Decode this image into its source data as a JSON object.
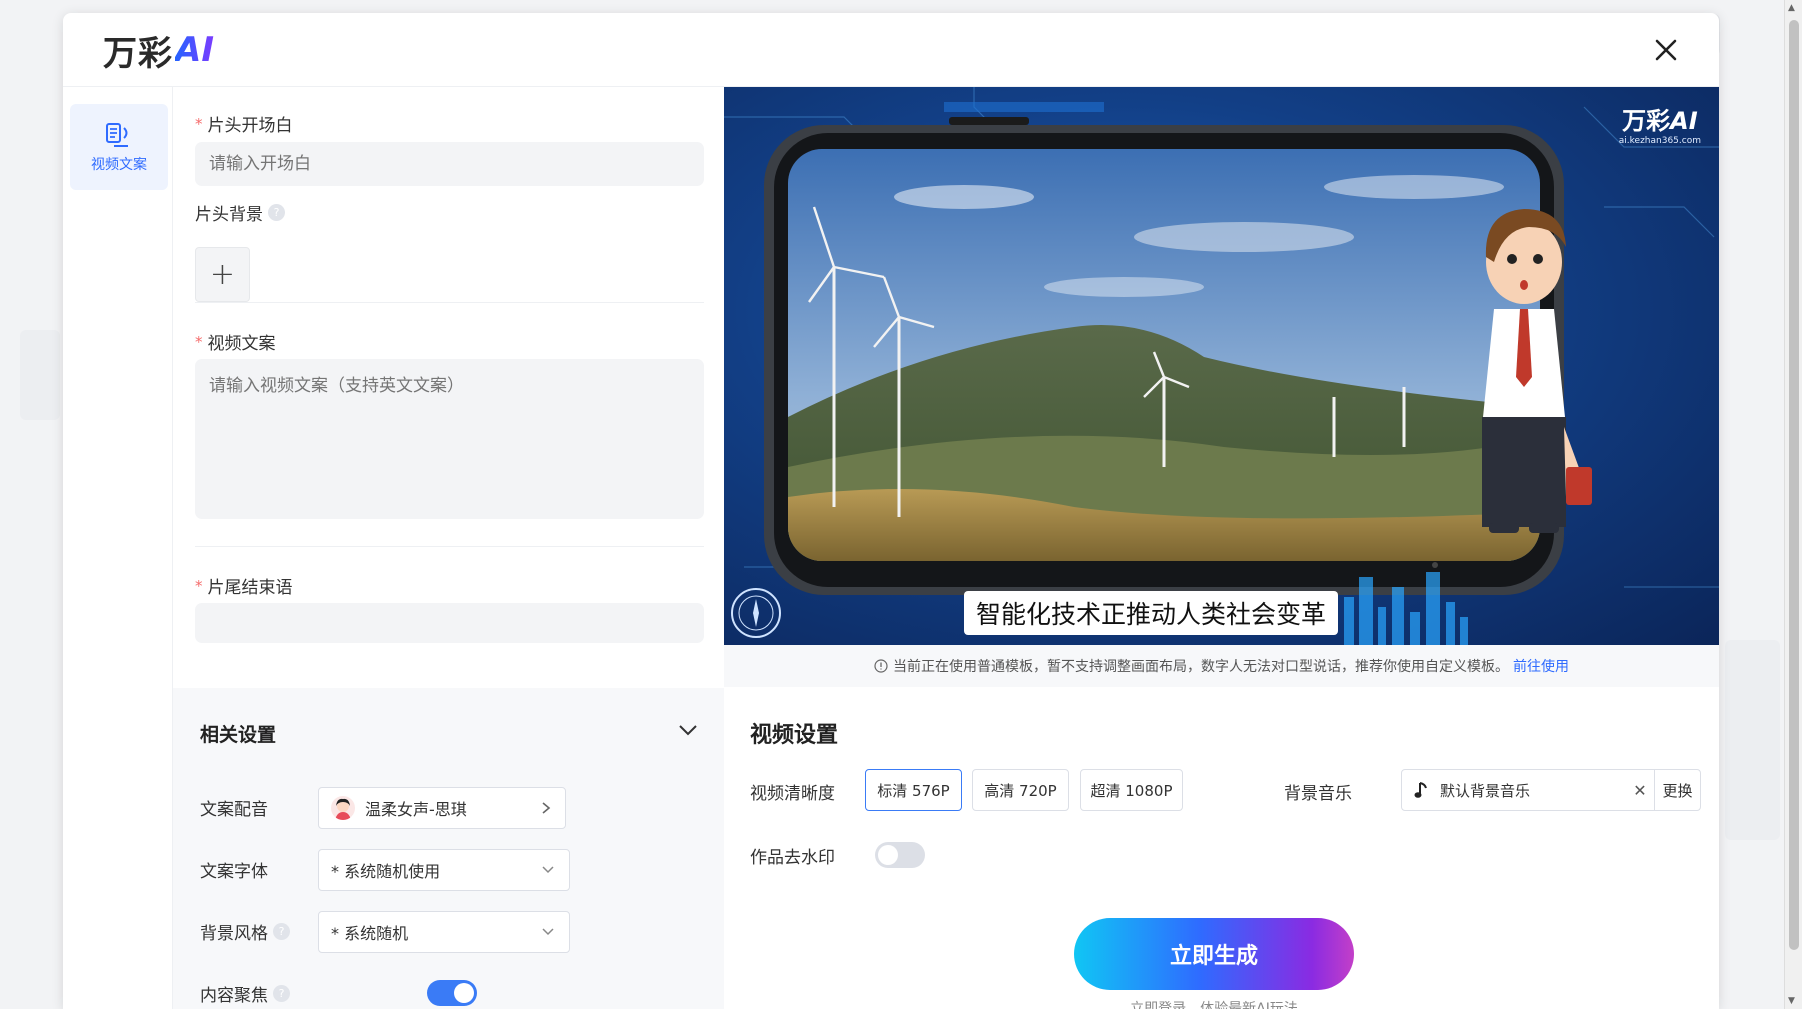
{
  "header": {
    "logo_cn": "万彩",
    "logo_ai": "AI"
  },
  "nav": {
    "items": [
      {
        "label": "视频文案",
        "icon": "script-icon"
      }
    ]
  },
  "form": {
    "opening": {
      "label": "片头开场白",
      "placeholder": "请输入开场白"
    },
    "opening_bg": {
      "label": "片头背景"
    },
    "script": {
      "label": "视频文案",
      "placeholder": "请输入视频文案（支持英文文案）"
    },
    "closing": {
      "label": "片尾结束语"
    }
  },
  "related": {
    "title": "相关设置",
    "voice": {
      "label": "文案配音",
      "value": "温柔女声-思琪"
    },
    "font": {
      "label": "文案字体",
      "value": "* 系统随机使用"
    },
    "bg_style": {
      "label": "背景风格",
      "value": "* 系统随机"
    },
    "focus": {
      "label": "内容聚焦",
      "enabled": true
    }
  },
  "preview": {
    "watermark_cn": "万彩",
    "watermark_ai": "AI",
    "watermark_url": "ai.kezhan365.com",
    "subtitle": "智能化技术正推动人类社会变革"
  },
  "notice": {
    "text": "当前正在使用普通模板，暂不支持调整画面布局，数字人无法对口型说话，推荐你使用自定义模板。",
    "link": "前往使用"
  },
  "video_settings": {
    "title": "视频设置",
    "resolution_label": "视频清晰度",
    "resolutions": [
      {
        "label": "标清 576P",
        "active": true
      },
      {
        "label": "高清 720P",
        "active": false
      },
      {
        "label": "超清 1080P",
        "active": false
      }
    ],
    "music_label": "背景音乐",
    "music_value": "默认背景音乐",
    "music_change": "更换",
    "watermark_label": "作品去水印",
    "watermark_enabled": false,
    "generate": "立即生成",
    "generate_sub": "立即登录，体验最新AI玩法"
  },
  "colors": {
    "accent": "#3a7bf6",
    "required": "#f56c6c",
    "link": "#2f6bff"
  }
}
